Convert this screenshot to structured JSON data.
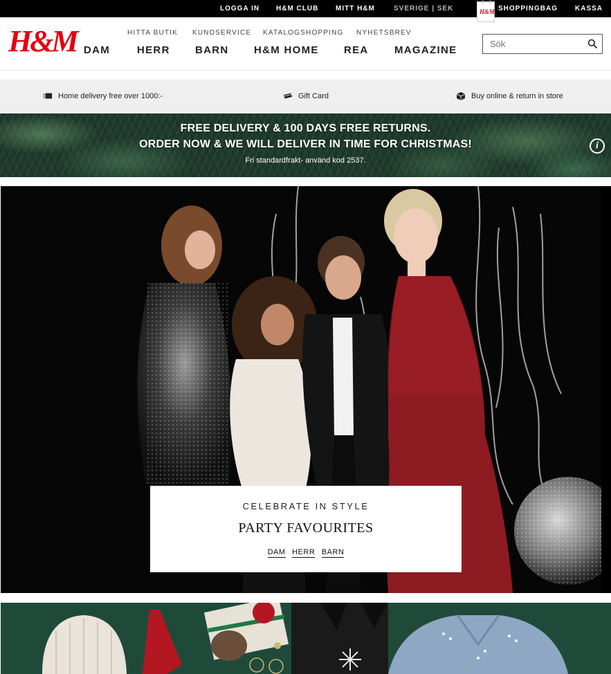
{
  "topbar": {
    "login": "LOGGA IN",
    "club": "H&M CLUB",
    "my_hm": "MITT H&M",
    "region": "SVERIGE | SEK",
    "bag_logo": "H&M",
    "bag": "SHOPPINGBAG",
    "checkout": "KASSA"
  },
  "header": {
    "logo": "H&M",
    "sublinks": [
      "HITTA BUTIK",
      "KUNDSERVICE",
      "KATALOGSHOPPING",
      "NYHETSBREV"
    ],
    "nav": [
      "DAM",
      "HERR",
      "BARN",
      "H&M HOME",
      "REA",
      "MAGAZINE"
    ],
    "search_placeholder": "Sök"
  },
  "services": [
    {
      "icon": "delivery-truck-icon",
      "label": "Home delivery free over 1000:-"
    },
    {
      "icon": "gift-card-icon",
      "label": "Gift Card"
    },
    {
      "icon": "package-box-icon",
      "label": "Buy online & return in store"
    }
  ],
  "promo": {
    "line1": "FREE DELIVERY & 100 DAYS FREE RETURNS.",
    "line2": "ORDER NOW & WE WILL DELIVER IN TIME FOR CHRISTMAS!",
    "small": "Fri standardfrakt- använd kod 2537."
  },
  "hero": {
    "kicker": "CELEBRATE IN STYLE",
    "title": "PARTY FAVOURITES",
    "links": [
      "DAM",
      "HERR",
      "BARN"
    ]
  },
  "colors": {
    "brand_red": "#e50010",
    "promo_green": "#1e3a2c",
    "teaser_green": "#1f4a3a"
  }
}
